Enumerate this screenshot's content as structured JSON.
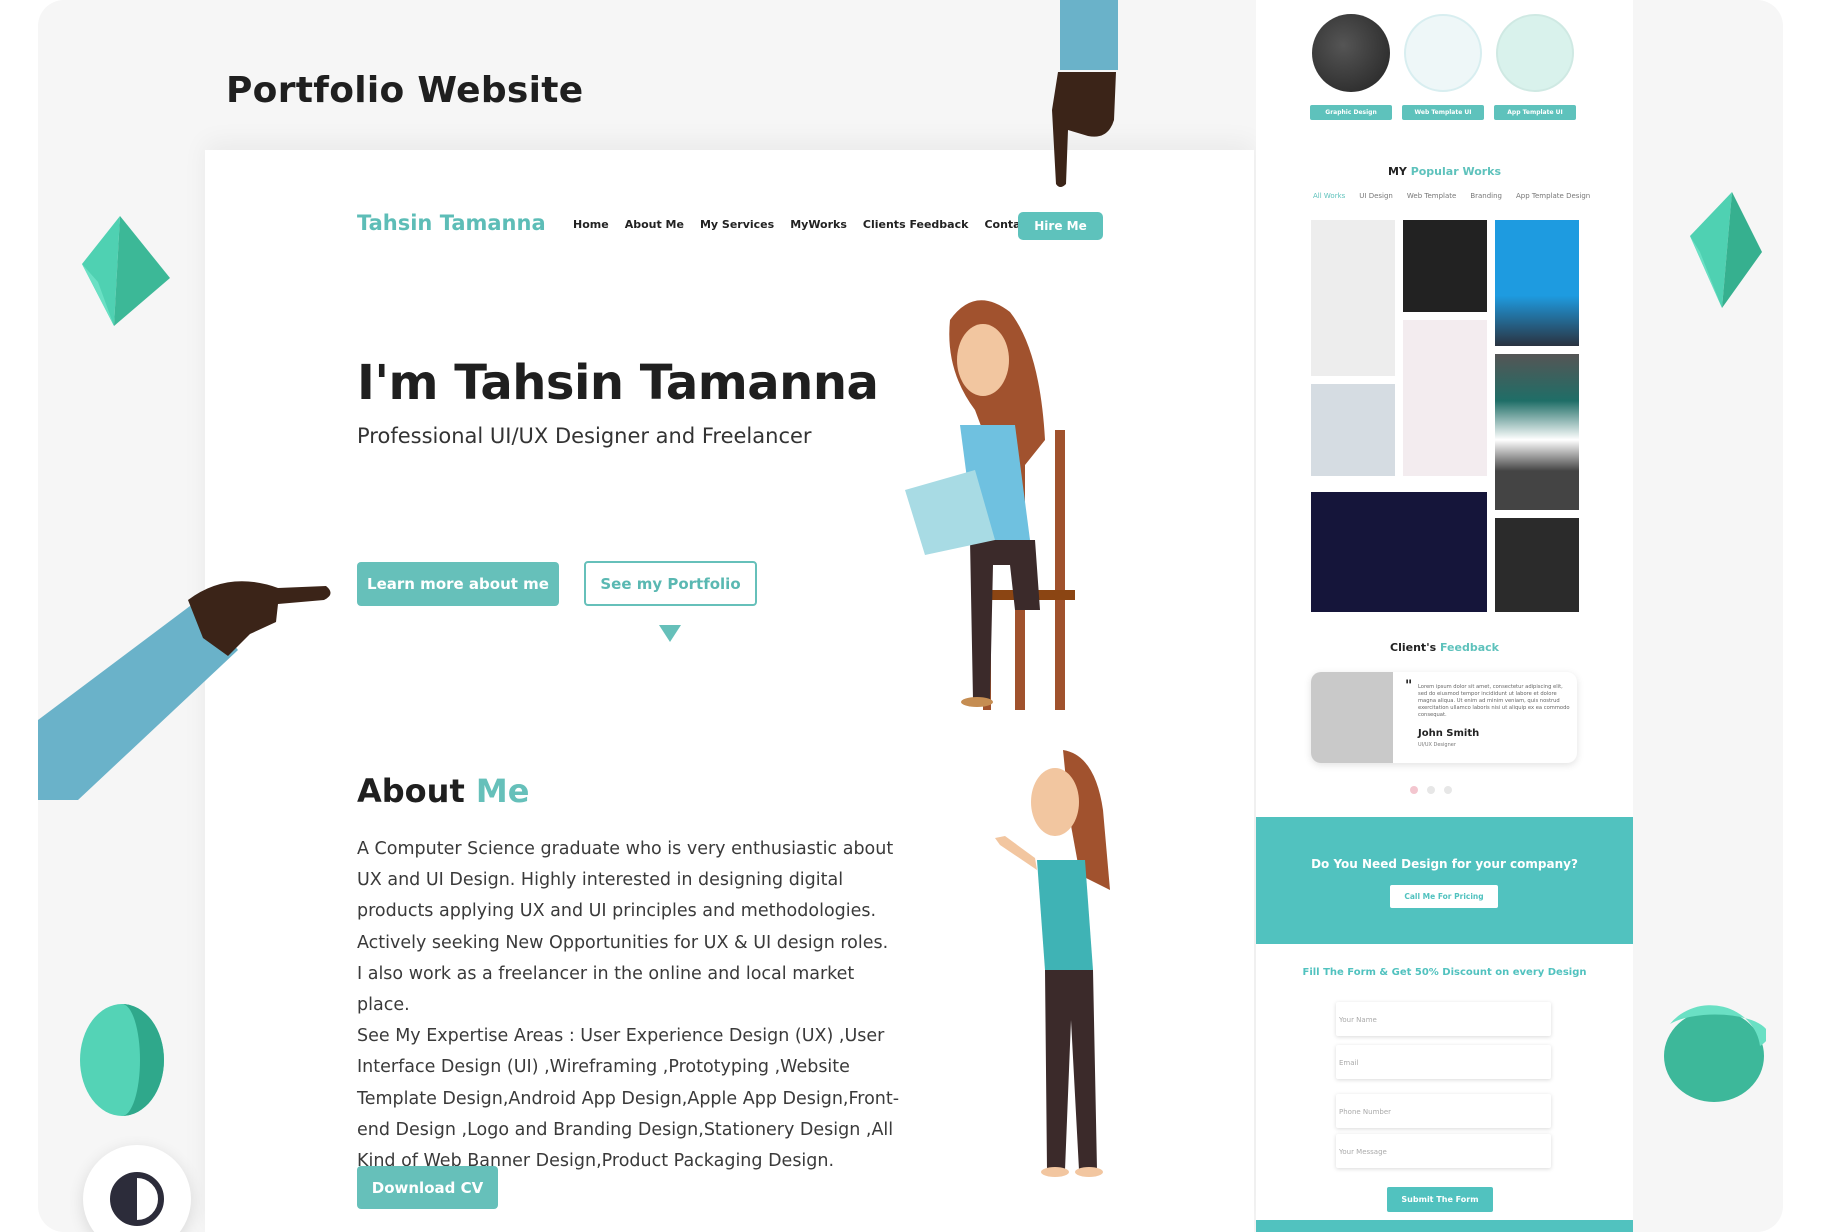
{
  "showcase": {
    "title": "Portfolio Website"
  },
  "brand": {
    "name": "Tahsin Tamanna"
  },
  "nav": {
    "items": [
      {
        "label": "Home"
      },
      {
        "label": "About Me"
      },
      {
        "label": "My Services"
      },
      {
        "label": "MyWorks"
      },
      {
        "label": "Clients Feedback"
      },
      {
        "label": "Contact"
      }
    ],
    "hire_label": "Hire Me"
  },
  "hero": {
    "title": "I'm Tahsin Tamanna",
    "subtitle": "Professional UI/UX Designer and Freelancer",
    "learn_label": "Learn more about me",
    "portfolio_label": "See my Portfolio"
  },
  "about": {
    "title_plain": "About ",
    "title_accent": "Me",
    "lines": [
      "A Computer Science graduate who is very enthusiastic about",
      "UX and UI Design. Highly interested in designing digital",
      "products applying UX and UI principles and methodologies.",
      "Actively seeking New Opportunities for UX & UI design roles.",
      "I also work as a freelancer in the online and local market place.",
      "See My Expertise Areas : User Experience Design (UX) ,User",
      "Interface Design (UI) ,Wireframing ,Prototyping ,Website",
      "Template Design,Android App Design,Apple App Design,Front-",
      "end Design ,Logo and Branding Design,Stationery Design ,All",
      "Kind of Web Banner Design,Product Packaging Design."
    ],
    "download_label": "Download CV"
  },
  "services": {
    "items": [
      {
        "label": "Graphic Design"
      },
      {
        "label": "Web Template UI"
      },
      {
        "label": "App Template UI"
      }
    ]
  },
  "works": {
    "title_plain": "MY ",
    "title_accent": "Popular Works",
    "filters": [
      {
        "label": "All Works",
        "active": true
      },
      {
        "label": "UI Design",
        "active": false
      },
      {
        "label": "Web Template",
        "active": false
      },
      {
        "label": "Branding",
        "active": false
      },
      {
        "label": "App Template Design",
        "active": false
      }
    ]
  },
  "feedback": {
    "title_plain": "Client's ",
    "title_accent": "Feedback",
    "quote_mark": "\"",
    "text": "Lorem ipsum dolor sit amet, consectetur adipiscing elit, sed do eiusmod tempor incididunt ut labore et dolore magna aliqua. Ut enim ad minim veniam, quis nostrud exercitation ullamco laboris nisi ut aliquip ex ea commodo consequat.",
    "name": "John Smith",
    "role": "UI/UX Designer"
  },
  "cta": {
    "question": "Do You Need Design for your company?",
    "button_label": "Call Me For Pricing"
  },
  "form": {
    "title": "Fill The Form & Get 50% Discount on every Design",
    "fields": [
      {
        "placeholder": "Your Name"
      },
      {
        "placeholder": "Email"
      },
      {
        "placeholder": "Phone Number"
      },
      {
        "placeholder": "Your Message"
      }
    ],
    "submit_label": "Submit The Form"
  },
  "colors": {
    "accent": "#66c0ba",
    "dark": "#1f1f1f",
    "band": "#51c2bf"
  },
  "icons": {
    "theme": "contrast-icon",
    "hand_top": "pointing-hand-icon",
    "hand_left": "pointing-hand-icon"
  }
}
